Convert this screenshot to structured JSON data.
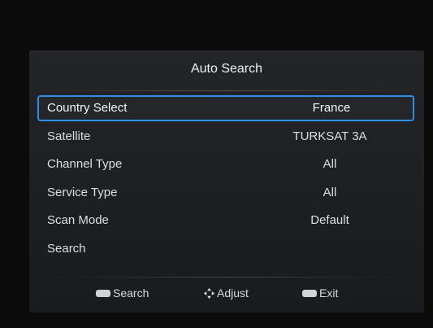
{
  "menu": {
    "title": "Auto Search",
    "items": [
      {
        "label": "Country Select",
        "value": "France",
        "selected": true
      },
      {
        "label": "Satellite",
        "value": "TURKSAT 3A"
      },
      {
        "label": "Channel Type",
        "value": "All"
      },
      {
        "label": "Service Type",
        "value": "All"
      },
      {
        "label": "Scan Mode",
        "value": "Default"
      },
      {
        "label": "Search",
        "value": ""
      }
    ]
  },
  "footer": {
    "ok_hint": "Search",
    "navigate_hint": "Adjust",
    "exit_hint": "Exit",
    "icons": [
      "ok-key-icon",
      "dpad-icon",
      "exit-key-icon"
    ]
  },
  "colors": {
    "selection_border": "#2a8fe6",
    "panel_background": "#1e2023",
    "text": "#dcdfe3"
  }
}
